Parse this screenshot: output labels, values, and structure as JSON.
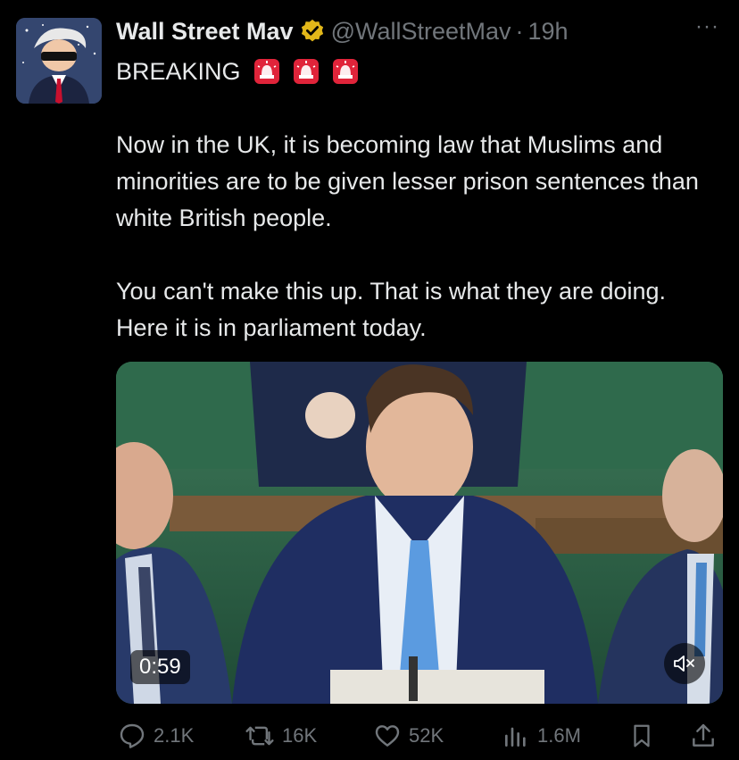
{
  "author": {
    "name": "Wall Street Mav",
    "handle": "@WallStreetMav",
    "separator": "·",
    "time": "19h",
    "more_label": "···",
    "verified_color": "#e2b719"
  },
  "tweet": {
    "headline": "BREAKING",
    "paragraph_1": "Now in the UK, it is becoming law that Muslims and minorities are to be given lesser prison sentences than white British people.",
    "paragraph_2": "You can't make this up. That is what they are doing. Here it is in parliament today."
  },
  "video": {
    "duration": "0:59",
    "muted": true
  },
  "actions": {
    "replies": "2.1K",
    "reposts": "16K",
    "likes": "52K",
    "views": "1.6M"
  },
  "icons": [
    "more-icon",
    "verified-icon",
    "siren-icon",
    "reply-icon",
    "repost-icon",
    "like-icon",
    "views-icon",
    "bookmark-icon",
    "share-icon",
    "mute-icon"
  ],
  "colors": {
    "background": "#000000",
    "text": "#e7e9ea",
    "muted": "#71767b",
    "siren_red": "#e0243a"
  }
}
